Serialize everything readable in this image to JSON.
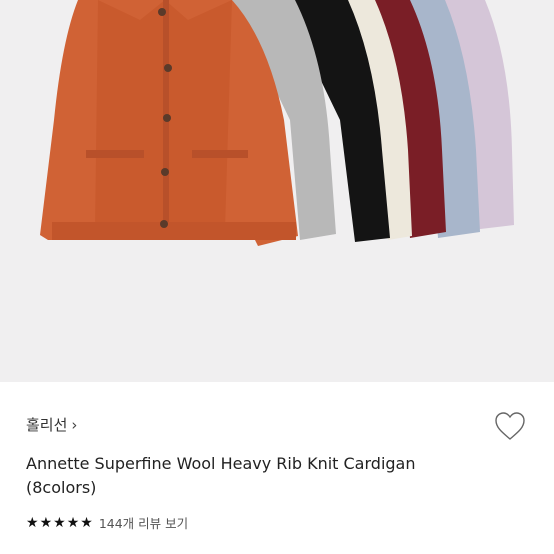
{
  "product": {
    "brand": "홀리선",
    "brand_chevron_glyph": "›",
    "title": "Annette Superfine Wool Heavy Rib Knit Cardigan (8colors)",
    "rating_stars": 5,
    "review_link": "144개 리뷰 보기"
  },
  "image": {
    "background": "#f0eff0",
    "cardigan_colors": [
      "#d5c6d8",
      "#a8b6cb",
      "#7a1e26",
      "#ede8dc",
      "#141414",
      "#b8b8b8",
      "#d06235"
    ]
  },
  "icons": {
    "wishlist": "heart-outline-icon",
    "star": "star-icon"
  }
}
